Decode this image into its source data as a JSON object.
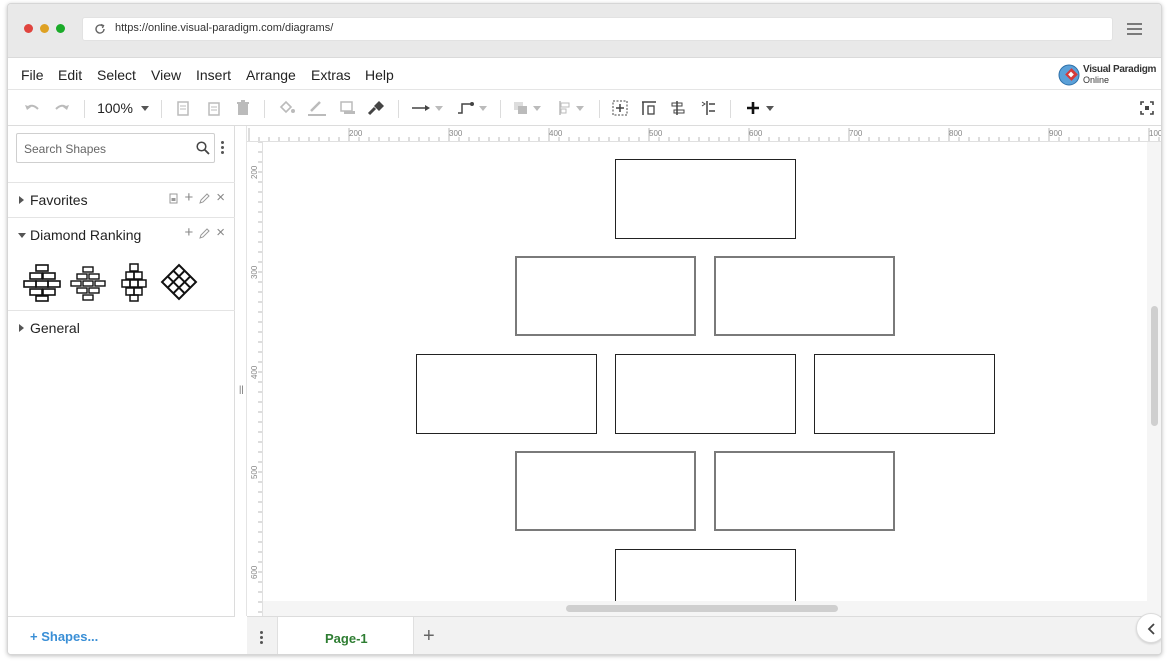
{
  "browser": {
    "url": "https://online.visual-paradigm.com/diagrams/",
    "dot_colors": [
      "#e0443e",
      "#dea123",
      "#1aab29"
    ]
  },
  "menubar": {
    "items": [
      "File",
      "Edit",
      "Select",
      "View",
      "Insert",
      "Arrange",
      "Extras",
      "Help"
    ],
    "logo_line1": "Visual Paradigm",
    "logo_line2": "Online"
  },
  "toolbar": {
    "zoom": "100%",
    "icons": [
      "undo-icon",
      "redo-icon",
      "copy-icon",
      "paste-icon",
      "delete-icon",
      "fill-color-icon",
      "line-color-icon",
      "shadow-icon",
      "format-painter-icon",
      "connector-icon",
      "waypoint-icon",
      "to-front-icon",
      "align-icon",
      "select-all-icon",
      "distribute-icon",
      "align-left-icon",
      "align-right-icon",
      "insert-icon",
      "fullscreen-icon"
    ]
  },
  "sidebar": {
    "search_placeholder": "Search Shapes",
    "sections": [
      {
        "label": "Favorites",
        "expanded": false
      },
      {
        "label": "Diamond Ranking",
        "expanded": true
      },
      {
        "label": "General",
        "expanded": false
      }
    ],
    "more_shapes": "+ Shapes..."
  },
  "ruler": {
    "top_labels": [
      "200",
      "300",
      "400",
      "500",
      "600",
      "700",
      "800",
      "900",
      "100"
    ],
    "left_labels": [
      "200",
      "300",
      "400",
      "500",
      "600"
    ]
  },
  "pages": {
    "tabs": [
      "Page-1"
    ],
    "add_label": "+"
  },
  "colors": {
    "accent_link": "#3a8fd6",
    "page_tab": "#2e7d32"
  }
}
